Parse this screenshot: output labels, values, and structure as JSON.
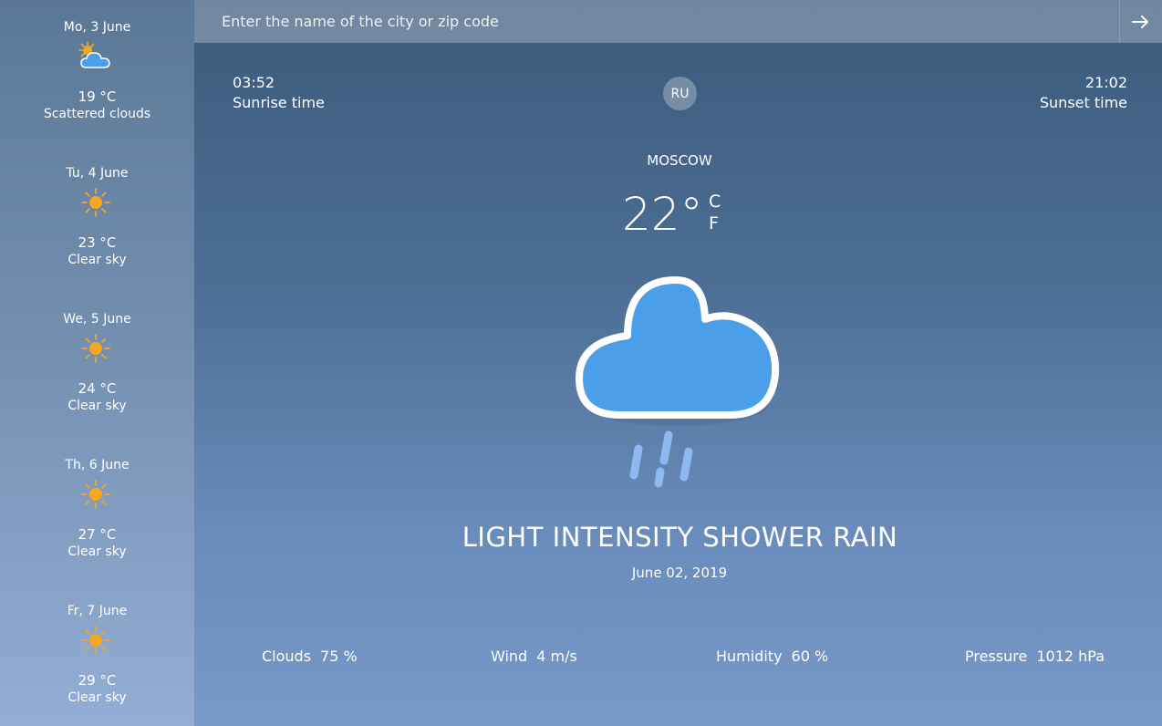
{
  "search": {
    "placeholder": "Enter the name of the city or zip code",
    "button_icon": "arrow-right-icon"
  },
  "sunrise": {
    "time": "03:52",
    "label": "Sunrise time"
  },
  "sunset": {
    "time": "21:02",
    "label": "Sunset time"
  },
  "language": "RU",
  "current": {
    "city": "MOSCOW",
    "temperature": "22°",
    "unit_c": "C",
    "unit_f": "F",
    "icon": "shower-rain-icon",
    "condition": "LIGHT INTENSITY SHOWER RAIN",
    "date": "June 02, 2019"
  },
  "stats": [
    {
      "label": "Clouds",
      "value": "75 %"
    },
    {
      "label": "Wind",
      "value": "4 m/s"
    },
    {
      "label": "Humidity",
      "value": "60 %"
    },
    {
      "label": "Pressure",
      "value": "1012 hPa"
    }
  ],
  "forecast": [
    {
      "date": "Mo, 3 June",
      "temp": "19 °C",
      "desc": "Scattered clouds",
      "icon": "scattered-clouds-icon"
    },
    {
      "date": "Tu, 4 June",
      "temp": "23 °C",
      "desc": "Clear sky",
      "icon": "sun-icon"
    },
    {
      "date": "We, 5 June",
      "temp": "24 °C",
      "desc": "Clear sky",
      "icon": "sun-icon"
    },
    {
      "date": "Th, 6 June",
      "temp": "27 °C",
      "desc": "Clear sky",
      "icon": "sun-icon"
    },
    {
      "date": "Fr, 7 June",
      "temp": "29 °C",
      "desc": "Clear sky",
      "icon": "sun-icon"
    }
  ],
  "colors": {
    "sun": "#f5a623",
    "cloud": "#4a9fe8",
    "rain": "#8fb8f0"
  }
}
